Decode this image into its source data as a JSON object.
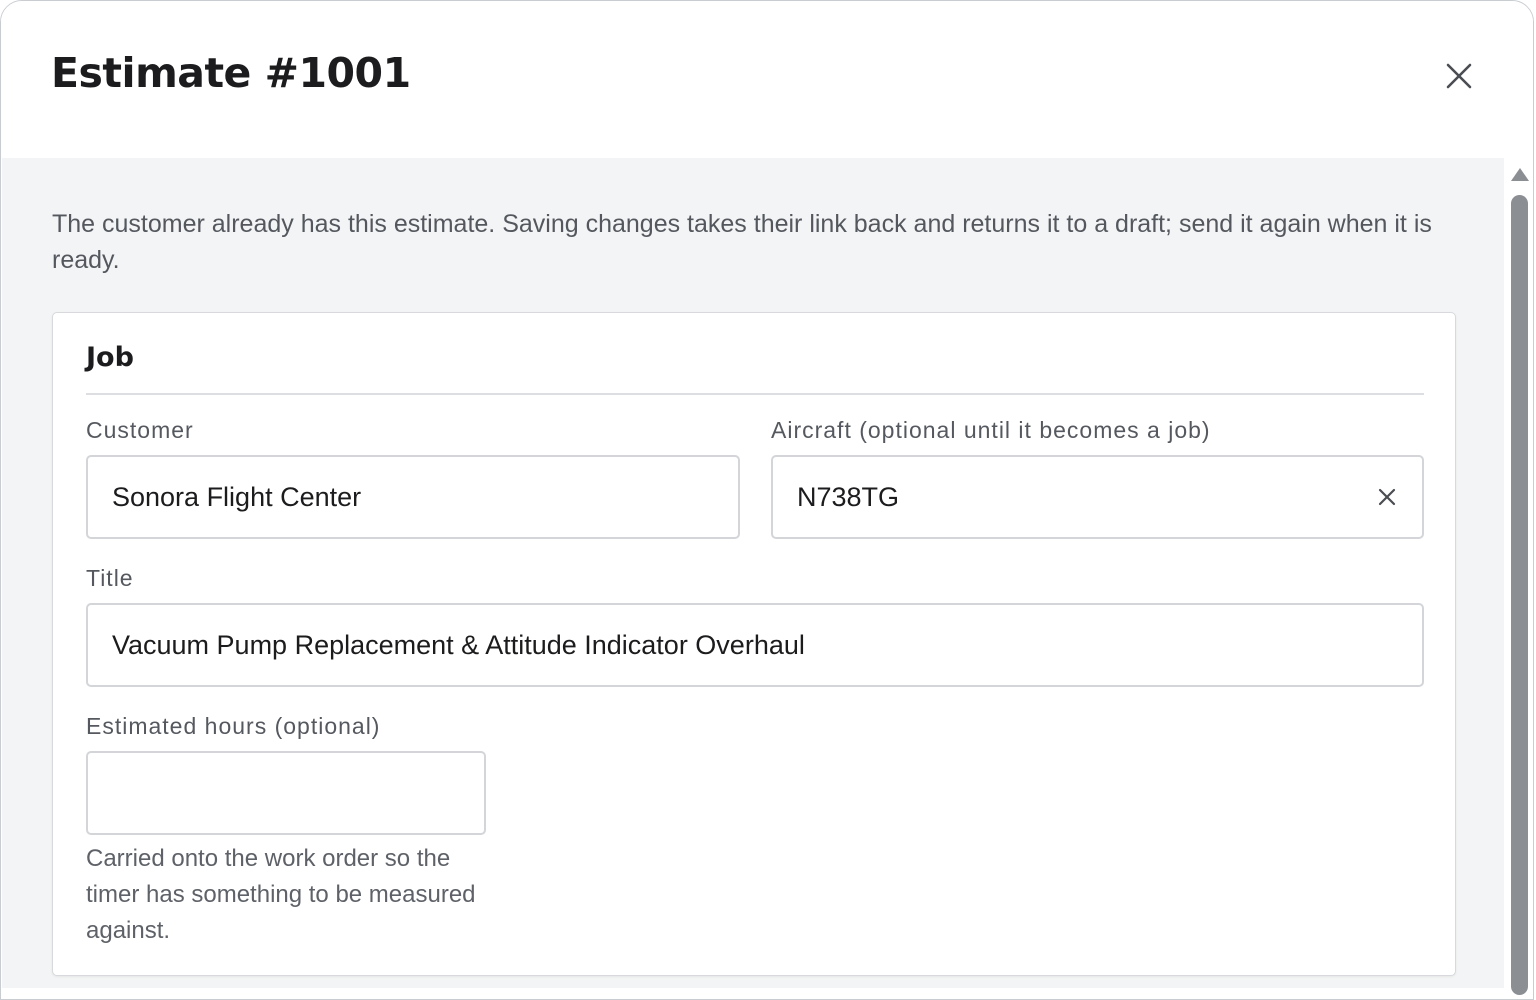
{
  "modal": {
    "title": "Estimate #1001",
    "close_icon": "close-icon"
  },
  "notice": "The customer already has this estimate. Saving changes takes their link back and returns it to a draft; send it again when it is ready.",
  "job": {
    "section_title": "Job",
    "customer": {
      "label": "Customer",
      "value": "Sonora Flight Center"
    },
    "aircraft": {
      "label": "Aircraft (optional until it becomes a job)",
      "value": "N738TG",
      "clear_icon": "clear-icon"
    },
    "title": {
      "label": "Title",
      "value": "Vacuum Pump Replacement & Attitude Indicator Overhaul"
    },
    "estimated_hours": {
      "label": "Estimated hours (optional)",
      "value": "",
      "hint": "Carried onto the work order so the timer has something to be measured against."
    }
  },
  "colors": {
    "body_background": "#f3f4f5",
    "text_primary": "#1c1c1e",
    "text_secondary": "#54585e",
    "border": "#d3d5d9",
    "scrollbar": "#8b8e93"
  }
}
